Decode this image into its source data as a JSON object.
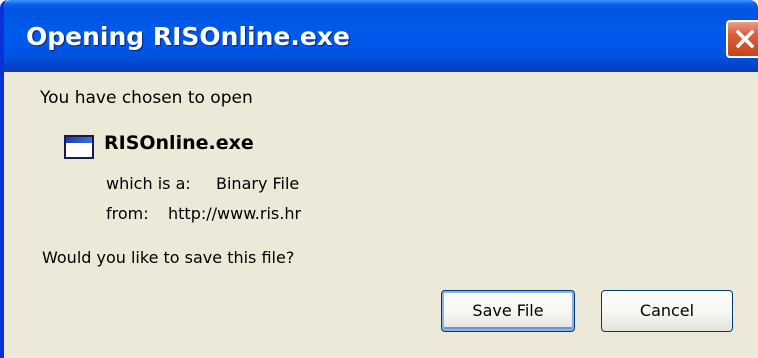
{
  "window": {
    "title": "Opening RISOnline.exe"
  },
  "dialog": {
    "intro": "You have chosen to open",
    "file": {
      "name": "RISOnline.exe",
      "type_label": "which is a:",
      "type_value": "Binary File",
      "from_label": "from:",
      "from_value": "http://www.ris.hr"
    },
    "question": "Would you like to save this file?"
  },
  "buttons": {
    "save_label": "Save File",
    "cancel_label": "Cancel"
  },
  "colors": {
    "titlebar": "#0054e3",
    "close_button": "#d9603d",
    "dialog_background": "#ece9d8"
  },
  "icons": {
    "close": "close-icon",
    "file": "application-window-icon"
  }
}
